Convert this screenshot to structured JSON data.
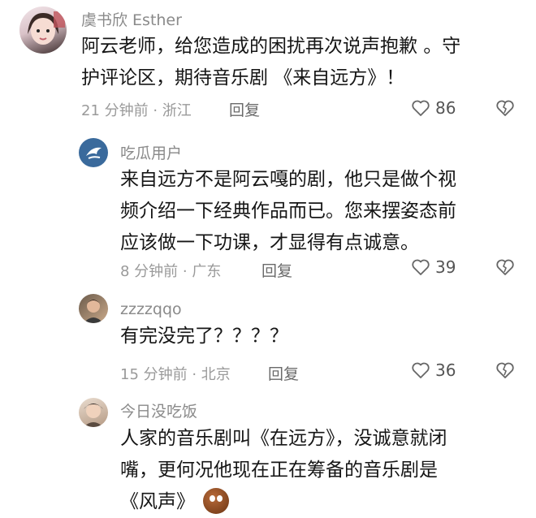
{
  "comments": [
    {
      "user": "虞书欣 Esther",
      "lines": [
        "阿云老师，给您造成的困扰再次说声抱歉 。守",
        "护评论区，期待音乐剧 《来自远方》！"
      ],
      "meta": "21 分钟前 · 浙江",
      "reply": "回复",
      "likes": "86"
    },
    {
      "user": "吃瓜用户",
      "lines": [
        "来自远方不是阿云嘎的剧，他只是做个视",
        "频介绍一下经典作品而已。您来摆姿态前",
        "应该做一下功课，才显得有点诚意。"
      ],
      "meta": "8 分钟前 · 广东",
      "reply": "回复",
      "likes": "39"
    },
    {
      "user": "zzzzqqo",
      "lines": [
        "有完没完了？？？？"
      ],
      "meta": "15 分钟前 · 北京",
      "reply": "回复",
      "likes": "36"
    },
    {
      "user": "今日没吃饭",
      "lines": [
        "人家的音乐剧叫《在远方》，没诚意就闭",
        "嘴，更何况他现在正在筹备的音乐剧是",
        "《风声》"
      ],
      "emoji": "face-emoji"
    }
  ],
  "colors": {
    "avatar_bird_bg": "#3a6a9c",
    "text": "#161616",
    "meta": "#9a9a9a"
  }
}
